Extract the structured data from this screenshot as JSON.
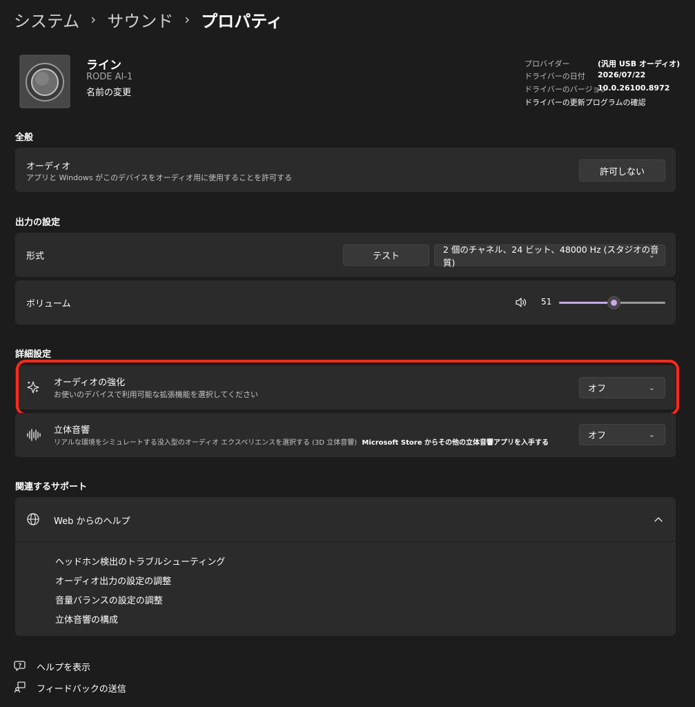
{
  "breadcrumb": {
    "items": [
      "システム",
      "サウンド",
      "プロパティ"
    ],
    "sep": "›"
  },
  "device": {
    "name": "ライン",
    "model": "RODE AI-1",
    "rename": "名前の変更"
  },
  "driver": {
    "provider_label": "プロバイダー",
    "provider_value": "(汎用 USB オーディオ)",
    "date_label": "ドライバーの日付",
    "date_value": "2026/07/22",
    "version_label": "ドライバーのバージョン",
    "version_value": "10.0.26100.8972",
    "update_link": "ドライバーの更新プログラムの確認"
  },
  "general": {
    "title": "全般",
    "audio_label": "オーディオ",
    "audio_desc": "アプリと Windows がこのデバイスをオーディオ用に使用することを許可する",
    "audio_button": "許可しない"
  },
  "output": {
    "title": "出力の設定",
    "format_label": "形式",
    "test_button": "テスト",
    "format_value": "2 個のチャネル、24 ビット、48000 Hz (スタジオの音質)",
    "volume_label": "ボリューム",
    "volume_value": "51",
    "volume_level": 51
  },
  "advanced": {
    "title": "詳細設定",
    "enhance_label": "オーディオの強化",
    "enhance_desc": "お使いのデバイスで利用可能な拡張機能を選択してください",
    "enhance_value": "オフ",
    "spatial_label": "立体音響",
    "spatial_desc": "リアルな環境をシミュレートする没入型のオーディオ エクスペリエンスを選択する (3D 立体音響)",
    "spatial_link": "Microsoft Store からその他の立体音響アプリを入手する",
    "spatial_value": "オフ",
    "highlight_color": "#ff2a1a"
  },
  "support": {
    "title": "関連するサポート",
    "web_help": "Web からのヘルプ",
    "links": [
      "ヘッドホン検出のトラブルシューティング",
      "オーディオ出力の設定の調整",
      "音量バランスの設定の調整",
      "立体音響の構成"
    ]
  },
  "footer": {
    "help": "ヘルプを表示",
    "feedback": "フィードバックの送信"
  },
  "colors": {
    "accent": "#c8a9e8",
    "background": "#1c1c1c",
    "card": "#2b2b2b"
  }
}
